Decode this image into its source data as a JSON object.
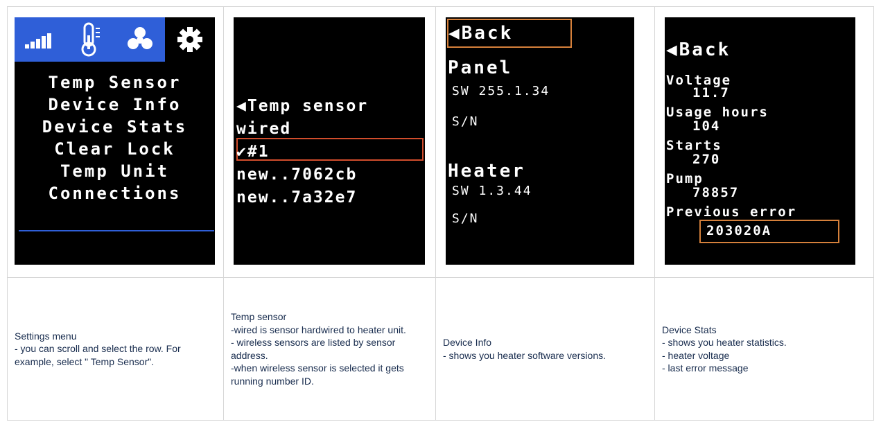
{
  "columns": [
    {
      "screen": {
        "menu": [
          "Temp Sensor",
          "Device Info",
          "Device Stats",
          "Clear Lock",
          "Temp Unit",
          "Connections"
        ],
        "tab_icons": [
          "signal-icon",
          "thermometer-icon",
          "fan-icon",
          "gear-icon"
        ],
        "active_tab": 3
      },
      "caption": "Settings menu\n- you can scroll and select the row. For example, select \" Temp Sensor\"."
    },
    {
      "screen": {
        "rows": [
          "◀Temp sensor",
          " wired",
          "✔#1",
          " new..7062cb",
          " new..7a32e7"
        ],
        "selected_row": 2
      },
      "caption": "Temp sensor\n-wired  is sensor hardwired to heater unit.\n- wireless sensors are listed by sensor address.\n -when wireless sensor is selected it gets running number ID."
    },
    {
      "screen": {
        "back": "◀Back",
        "panel_title": "Panel",
        "panel_sw": "SW 255.1.34",
        "panel_sn": "S/N",
        "heater_title": "Heater",
        "heater_sw": "SW 1.3.44",
        "heater_sn": "S/N"
      },
      "caption": "Device Info\n- shows you heater software versions."
    },
    {
      "screen": {
        "back": "◀Back",
        "voltage_label": "Voltage",
        "voltage": "11.7",
        "usage_label": "Usage hours",
        "usage": "104",
        "starts_label": "Starts",
        "starts": "270",
        "pump_label": "Pump",
        "pump": "78857",
        "error_label": "Previous error",
        "error": "203020A"
      },
      "caption": "Device Stats\n- shows you heater statistics.\n- heater voltage\n- last error message"
    }
  ],
  "colors": {
    "tab_blue": "#2f5fd8",
    "highlight_red": "#d24d2c",
    "highlight_orange": "#d5803b",
    "caption_text": "#172b4d",
    "border": "#d6d6d6"
  }
}
